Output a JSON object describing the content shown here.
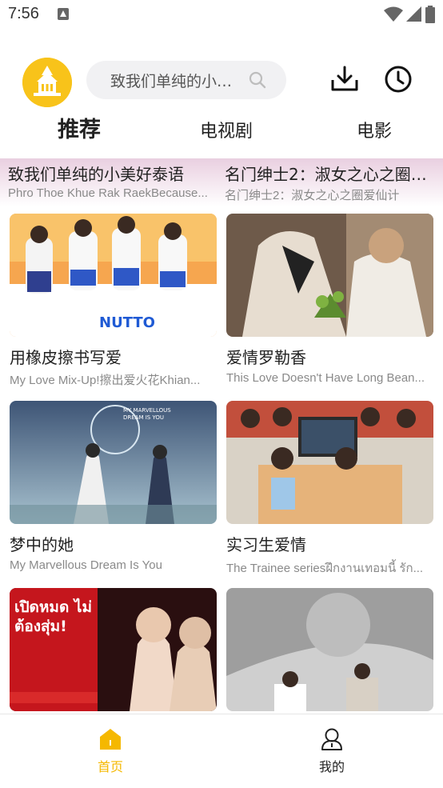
{
  "status_bar": {
    "time": "7:56",
    "icons": [
      "notification-icon",
      "wifi-icon",
      "signal-icon",
      "battery-icon"
    ]
  },
  "header": {
    "logo_icon": "temple-logo",
    "search_placeholder": "致我们单纯的小美好泰语",
    "download_icon": "download-icon",
    "history_icon": "clock-icon"
  },
  "tabs": [
    {
      "label": "推荐",
      "active": true
    },
    {
      "label": "电视剧",
      "active": false
    },
    {
      "label": "电影",
      "active": false
    }
  ],
  "partial_row": [
    {
      "title": "致我们单纯的小美好泰语",
      "subtitle": "Phro Thoe Khue Rak RaekBecause..."
    },
    {
      "title": "名门绅士2：淑女之心之圈爱仙计",
      "subtitle": "名门绅士2：淑女之心之圈爱仙计"
    }
  ],
  "cards": [
    {
      "title": "用橡皮擦书写爱",
      "subtitle": "My Love Mix-Up!擦出爱火花Khian...",
      "poster_text": "NUTTO"
    },
    {
      "title": "爱情罗勒香",
      "subtitle": "This Love Doesn't Have Long Bean...",
      "poster_text": ""
    },
    {
      "title": "梦中的她",
      "subtitle": "My Marvellous Dream Is You",
      "poster_text": "MY MARVELLOUS DREAM IS YOU"
    },
    {
      "title": "实习生爱情",
      "subtitle": "The Trainee seriesฝึกงานเทอมนี้ รัก...",
      "poster_text": ""
    },
    {
      "title": "",
      "subtitle": "",
      "poster_text": "เปิดหมด ไม่ต้องสุ่ม!"
    },
    {
      "title": "",
      "subtitle": "",
      "poster_text": ""
    }
  ],
  "bottom_nav": [
    {
      "label": "首页",
      "icon": "home-icon",
      "active": true
    },
    {
      "label": "我的",
      "icon": "user-icon",
      "active": false
    }
  ],
  "colors": {
    "accent": "#f5b800",
    "search_bg": "#f1f1f3",
    "subtitle": "#8a8a8a"
  }
}
